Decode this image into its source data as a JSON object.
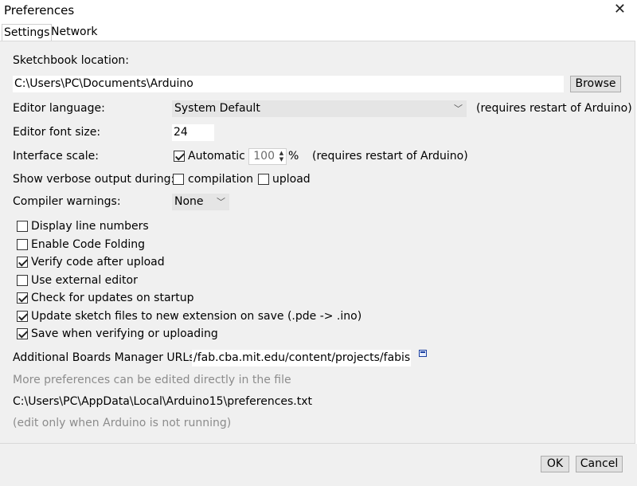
{
  "window": {
    "title": "Preferences",
    "close_icon": "close-icon"
  },
  "tabs": [
    {
      "label": "Settings",
      "active": true
    },
    {
      "label": "Network",
      "active": false
    }
  ],
  "sketchbook": {
    "label": "Sketchbook location:",
    "value": "C:\\Users\\PC\\Documents\\Arduino",
    "browse_label": "Browse"
  },
  "editor_language": {
    "label": "Editor language:",
    "value": "System Default",
    "note": "(requires restart of Arduino)"
  },
  "font_size": {
    "label": "Editor font size:",
    "value": "24"
  },
  "interface_scale": {
    "label": "Interface scale:",
    "automatic_label": "Automatic",
    "automatic_checked": true,
    "value": "100",
    "unit": "%",
    "note": "(requires restart of Arduino)"
  },
  "verbose": {
    "label": "Show verbose output during:",
    "compilation_label": "compilation",
    "compilation_checked": false,
    "upload_label": "upload",
    "upload_checked": false
  },
  "compiler_warnings": {
    "label": "Compiler warnings:",
    "value": "None"
  },
  "options": [
    {
      "label": "Display line numbers",
      "checked": false
    },
    {
      "label": "Enable Code Folding",
      "checked": false
    },
    {
      "label": "Verify code after upload",
      "checked": true
    },
    {
      "label": "Use external editor",
      "checked": false
    },
    {
      "label": "Check for updates on startup",
      "checked": true
    },
    {
      "label": "Update sketch files to new extension on save (.pde -> .ino)",
      "checked": true
    },
    {
      "label": "Save when verifying or uploading",
      "checked": true
    }
  ],
  "boards_urls": {
    "label": "Additional Boards Manager URLs:",
    "value": "/fab.cba.mit.edu/content/projects/fabisp/",
    "icon": "window-icon"
  },
  "info": {
    "more_prefs": "More preferences can be edited directly in the file",
    "prefs_path": "C:\\Users\\PC\\AppData\\Local\\Arduino15\\preferences.txt",
    "edit_note": "(edit only when Arduino is not running)"
  },
  "buttons": {
    "ok_label": "OK",
    "cancel_label": "Cancel"
  }
}
